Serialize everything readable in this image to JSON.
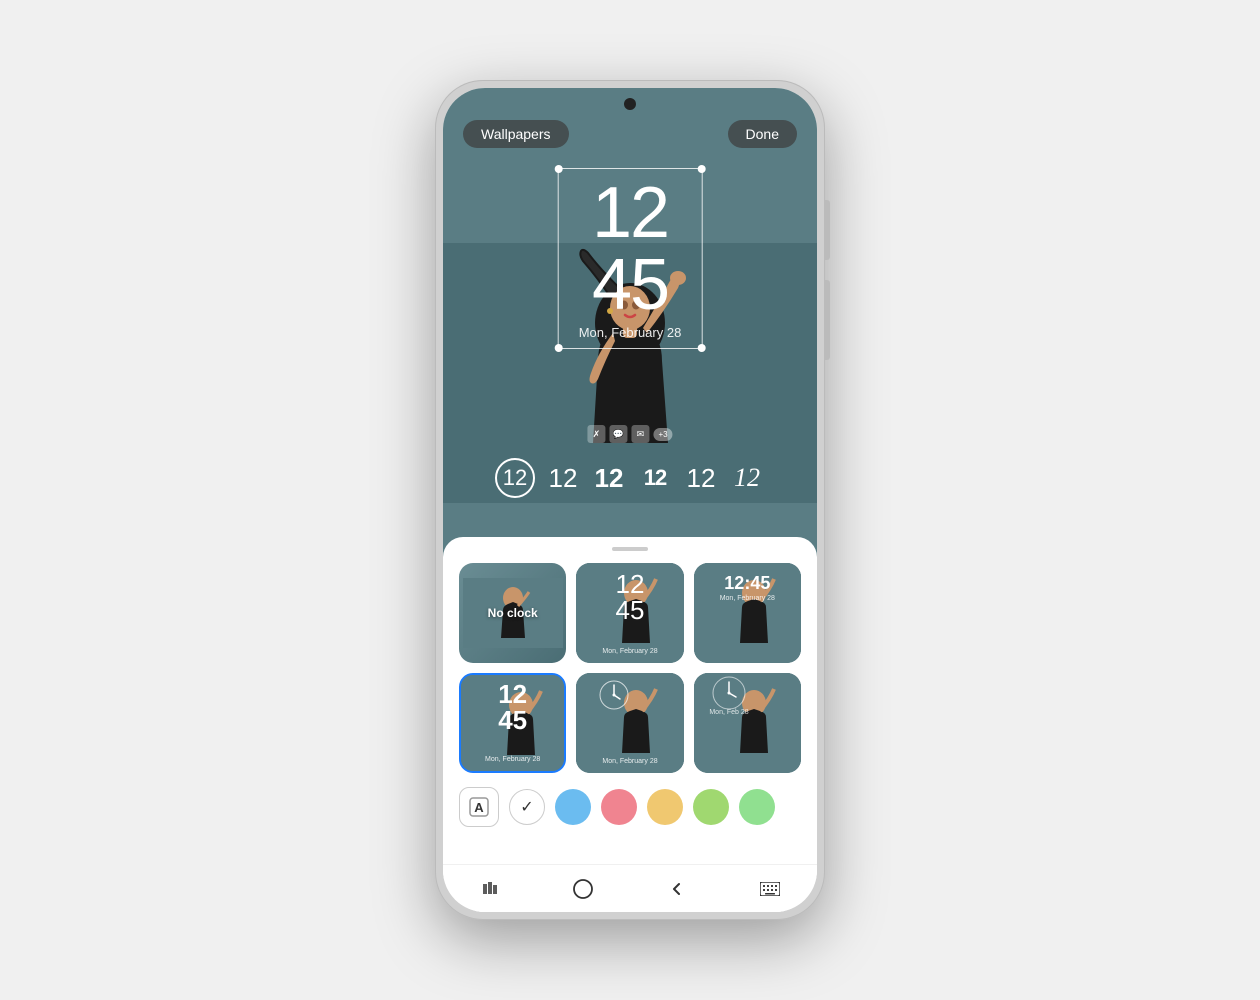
{
  "phone": {
    "lockscreen": {
      "wallpapers_btn": "Wallpapers",
      "done_btn": "Done",
      "clock_hours": "12",
      "clock_minutes": "45",
      "clock_date": "Mon, February 28",
      "font_options": [
        "12",
        "12",
        "12",
        "12",
        "12",
        "12"
      ]
    },
    "bottom_sheet": {
      "clock_options": [
        {
          "id": "no-clock",
          "label": "No clock",
          "type": "no-clock"
        },
        {
          "id": "style-1",
          "label": "12:45",
          "type": "two-line",
          "hours": "12",
          "minutes": "45",
          "date": "Mon, February 28"
        },
        {
          "id": "style-2",
          "label": "12:45",
          "type": "inline",
          "time": "12:45",
          "date": "Mon, February 28"
        },
        {
          "id": "style-3",
          "label": "12:45",
          "type": "two-line-bold",
          "hours": "12",
          "minutes": "45",
          "date": "Mon, February 28",
          "selected": true
        },
        {
          "id": "style-4",
          "label": "analog",
          "type": "analog",
          "date": "Mon, February 28"
        },
        {
          "id": "style-5",
          "label": "analog-2",
          "type": "analog2",
          "date": "Mon, February 28"
        }
      ],
      "colors": [
        {
          "id": "white-check",
          "type": "check"
        },
        {
          "id": "blue",
          "hex": "#6bbcf0"
        },
        {
          "id": "pink",
          "hex": "#f0848c"
        },
        {
          "id": "yellow",
          "hex": "#f0c878"
        },
        {
          "id": "green",
          "hex": "#a0d878"
        },
        {
          "id": "more",
          "hex": "#a0e8a0"
        }
      ]
    },
    "nav": {
      "recents": "|||",
      "home": "○",
      "back": "‹",
      "keyboard": "⌨"
    }
  }
}
